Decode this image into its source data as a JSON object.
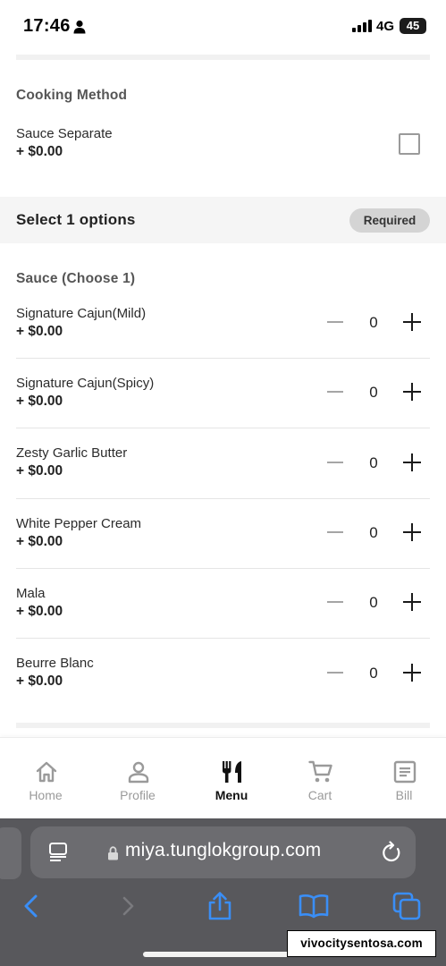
{
  "status_bar": {
    "time": "17:46",
    "network": "4G",
    "battery": "45"
  },
  "cooking_method": {
    "label": "Cooking Method",
    "options": [
      {
        "name": "Sauce Separate",
        "price": "+ $0.00",
        "checked": false
      }
    ]
  },
  "select_section": {
    "title": "Select 1 options",
    "badge": "Required"
  },
  "sauce": {
    "label": "Sauce (Choose 1)",
    "options": [
      {
        "name": "Signature Cajun(Mild)",
        "price": "+ $0.00",
        "qty": "0"
      },
      {
        "name": "Signature Cajun(Spicy)",
        "price": "+ $0.00",
        "qty": "0"
      },
      {
        "name": "Zesty Garlic Butter",
        "price": "+ $0.00",
        "qty": "0"
      },
      {
        "name": "White Pepper Cream",
        "price": "+ $0.00",
        "qty": "0"
      },
      {
        "name": "Mala",
        "price": "+ $0.00",
        "qty": "0"
      },
      {
        "name": "Beurre Blanc",
        "price": "+ $0.00",
        "qty": "0"
      }
    ]
  },
  "bottom_nav": {
    "items": [
      {
        "label": "Home",
        "icon": "home-icon",
        "active": false
      },
      {
        "label": "Profile",
        "icon": "profile-icon",
        "active": false
      },
      {
        "label": "Menu",
        "icon": "menu-utensils-icon",
        "active": true
      },
      {
        "label": "Cart",
        "icon": "cart-icon",
        "active": false
      },
      {
        "label": "Bill",
        "icon": "bill-icon",
        "active": false
      }
    ]
  },
  "browser": {
    "url": "miya.tunglokgroup.com"
  },
  "watermark": "vivocitysentosa.com",
  "colors": {
    "browser_bg": "#58585c",
    "url_box": "#6c6c70",
    "toolbar_icon": "#3a8ef6",
    "required_badge": "#d4d4d4"
  }
}
